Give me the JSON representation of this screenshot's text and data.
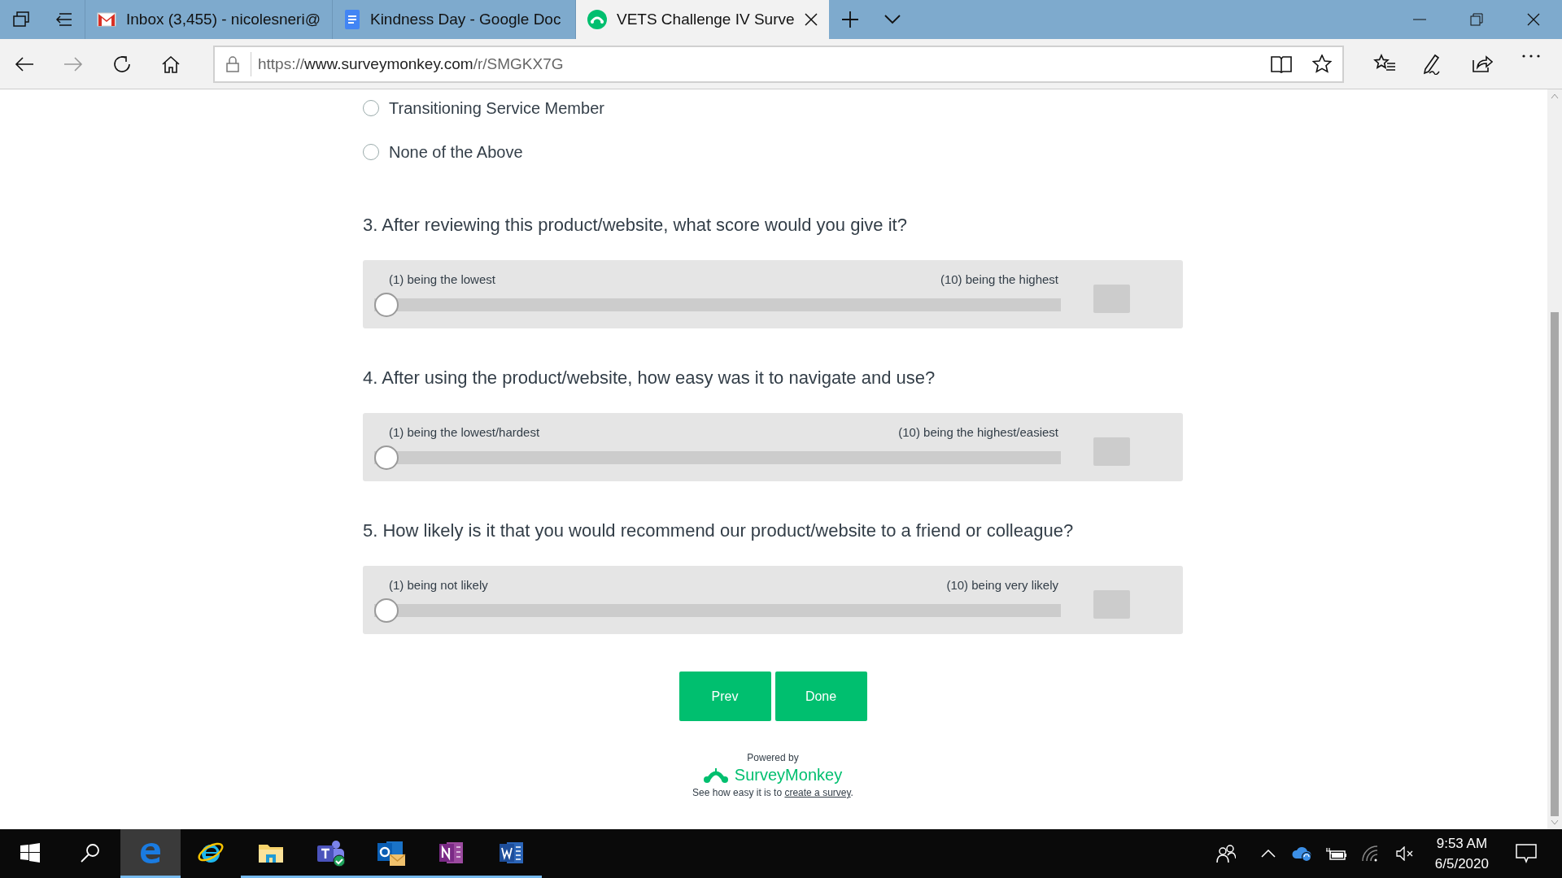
{
  "browser": {
    "tabs": [
      {
        "title": "Inbox (3,455) - nicolesneri@",
        "kind": "mail",
        "selected": false
      },
      {
        "title": "Kindness Day - Google Doc",
        "kind": "doc",
        "selected": false
      },
      {
        "title": "VETS Challenge IV Surve",
        "kind": "survey",
        "selected": true
      }
    ],
    "address": {
      "scheme": "https://",
      "host": "www.surveymonkey.com",
      "path": "/r/SMGKX7G"
    }
  },
  "survey": {
    "options": [
      {
        "label": "Transitioning Service Member",
        "selected": false
      },
      {
        "label": "None of the Above",
        "selected": false
      }
    ],
    "questions": [
      {
        "title": "3. After reviewing this product/website, what score would you give it?",
        "low_label": "(1) being the lowest",
        "high_label": "(10) being the highest",
        "level": 0
      },
      {
        "title": "4. After using the product/website, how easy was it to navigate and use?",
        "low_label": "(1) being the lowest/hardest",
        "high_label": "(10) being the highest/easiest",
        "level": 0
      },
      {
        "title": "5. How likely is it that you would recommend our product/website to a friend or colleague?",
        "low_label": "(1) being not likely",
        "high_label": "(10) being very likely",
        "level": 0
      }
    ],
    "buttons": [
      "Prev",
      "Done"
    ],
    "footer": {
      "powered_by": "Powered by",
      "brand": "SurveyMonkey",
      "tagline": "See how easy it is to ",
      "link": "create a survey",
      "tagline_end": "."
    }
  },
  "taskbar": {
    "apps": [
      {
        "kind": "edge",
        "active": true,
        "running": true
      },
      {
        "kind": "ie",
        "active": false,
        "running": false
      },
      {
        "kind": "explorer",
        "active": false,
        "running": true
      },
      {
        "kind": "teams",
        "active": false,
        "running": true
      },
      {
        "kind": "outlook",
        "active": false,
        "running": true
      },
      {
        "kind": "onenote",
        "active": false,
        "running": true
      },
      {
        "kind": "word",
        "active": false,
        "running": true
      }
    ],
    "time": "9:53 AM",
    "date": "6/5/2020"
  }
}
